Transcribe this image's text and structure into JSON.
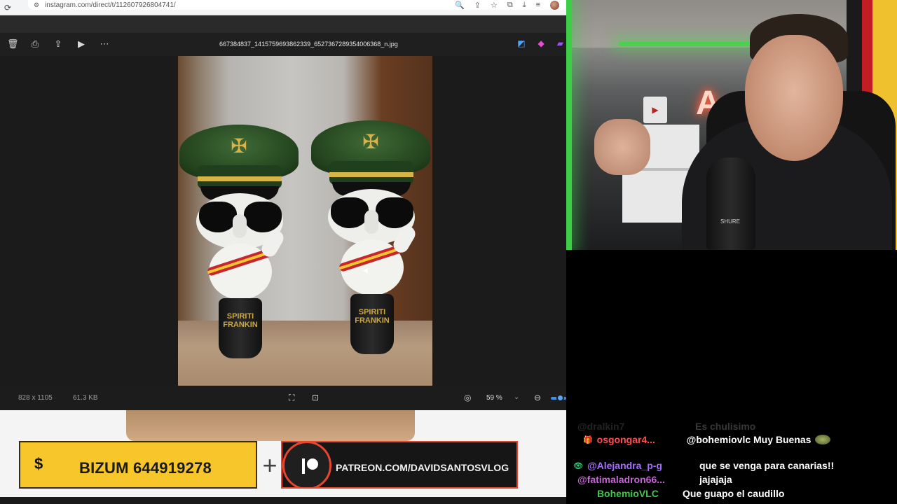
{
  "browser": {
    "url": "instagram.com/direct/t/112607926804741/",
    "icons": [
      "reload-icon",
      "site-settings-icon",
      "zoom-icon",
      "share-icon",
      "star-icon",
      "extensions-icon",
      "downloads-icon",
      "menu-icon",
      "profile-avatar"
    ]
  },
  "viewer": {
    "file_name": "667384837_1415759693862339_6527367289354006368_n.jpg",
    "dimensions": "828 x 1105",
    "file_size": "61.3 KB",
    "zoom": "59 %",
    "zoom_level": 0.59,
    "photo_labels": [
      "SPIRITI FRANKIN",
      "SPIRITI FRANKIN"
    ]
  },
  "banner": {
    "bizum_symbol": "$",
    "bizum_text": "BIZUM 644919278",
    "plus": "+",
    "patreon_text": "PATREON.COM/DAVIDSANTOSVLOG",
    "colors": {
      "bizum": "#f6c62b",
      "patreon_border": "#e8452f"
    }
  },
  "webcam": {
    "mic_brand": "SHURE"
  },
  "chat": {
    "messages": [
      {
        "user": "@dralkin7",
        "text": "Es chulisimo",
        "color": "#9e9e9e",
        "badges": "",
        "faded": true
      },
      {
        "user": "osgongar4...",
        "text": "@bohemiovlc Muy Buenas",
        "color": "#ff4f4f",
        "badges": "🎖🎁",
        "emote": true
      },
      {
        "user": "@Alejandra_p-g",
        "text": "que se venga para canarias!!",
        "color": "#a46dff",
        "badges": "👁"
      },
      {
        "user": "@fatimaladron66...",
        "text": "jajajaja",
        "color": "#c862d9",
        "badges": ""
      },
      {
        "user": "BohemioVLC",
        "text": "Que guapo el caudillo",
        "color": "#3fc84a",
        "badges": "👁🎖"
      }
    ]
  }
}
